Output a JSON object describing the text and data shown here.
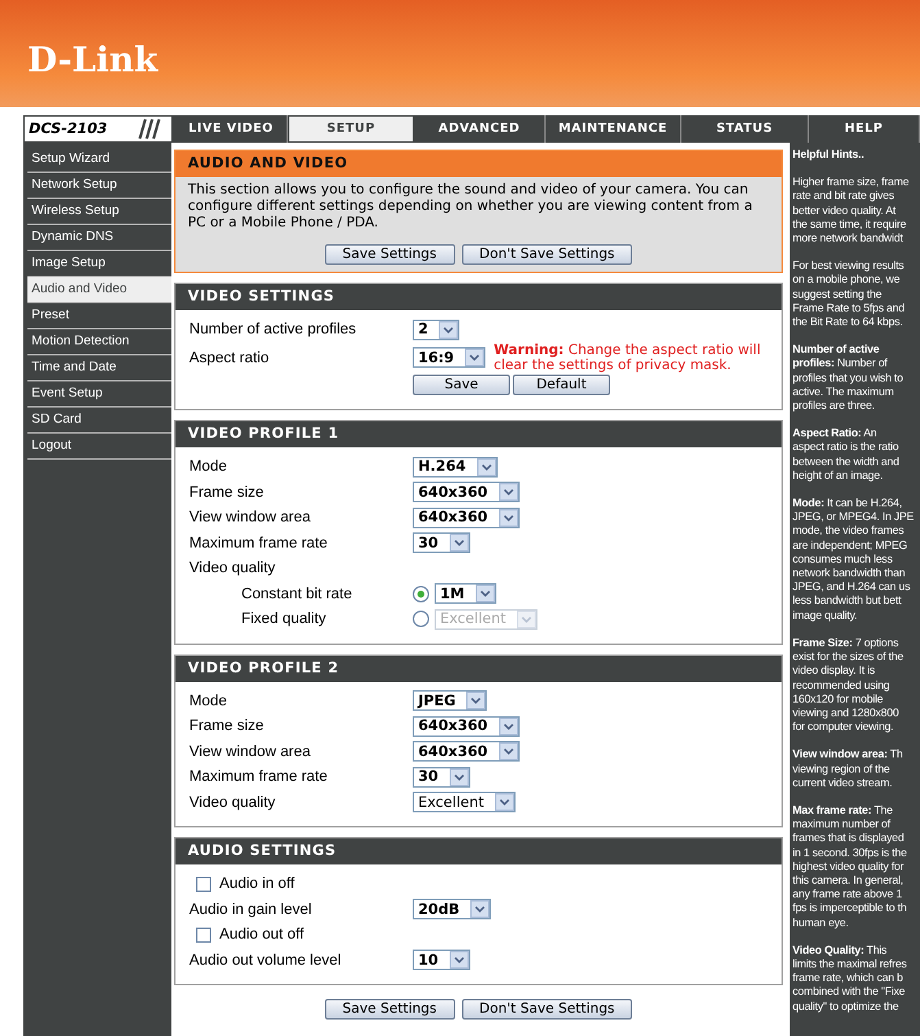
{
  "header": {
    "logo": "D-Link",
    "model": "DCS-2103"
  },
  "tabs": [
    {
      "label": "LIVE VIDEO",
      "selected": false
    },
    {
      "label": "SETUP",
      "selected": true
    },
    {
      "label": "ADVANCED",
      "selected": false
    },
    {
      "label": "MAINTENANCE",
      "selected": false
    },
    {
      "label": "STATUS",
      "selected": false
    },
    {
      "label": "HELP",
      "selected": false
    }
  ],
  "sidebar": {
    "items": [
      {
        "label": "Setup Wizard",
        "selected": false
      },
      {
        "label": "Network Setup",
        "selected": false
      },
      {
        "label": "Wireless Setup",
        "selected": false
      },
      {
        "label": "Dynamic DNS",
        "selected": false
      },
      {
        "label": "Image Setup",
        "selected": false
      },
      {
        "label": "Audio and Video",
        "selected": true
      },
      {
        "label": "Preset",
        "selected": false
      },
      {
        "label": "Motion Detection",
        "selected": false
      },
      {
        "label": "Time and Date",
        "selected": false
      },
      {
        "label": "Event Setup",
        "selected": false
      },
      {
        "label": "SD Card",
        "selected": false
      },
      {
        "label": "Logout",
        "selected": false
      }
    ]
  },
  "intro": {
    "title": "AUDIO AND VIDEO",
    "text": "This section allows you to configure the sound and video of your camera. You can configure different settings depending on whether you are viewing content from a PC or a Mobile Phone / PDA.",
    "buttons": [
      "Save Settings",
      "Don't Save Settings"
    ]
  },
  "sections": [
    {
      "title": "VIDEO SETTINGS",
      "rows": [
        {
          "kind": "select",
          "label": "Number of active profiles",
          "value": "2",
          "bold": true
        },
        {
          "kind": "warning",
          "label": "Aspect ratio",
          "value": "16:9",
          "bold": true,
          "warning": "**Warning:** Change the aspect ratio will clear the settings of privacy mask."
        },
        {
          "kind": "buttons",
          "buttons": [
            "Save",
            "Default"
          ]
        }
      ]
    },
    {
      "title": "VIDEO PROFILE 1",
      "rows": [
        {
          "kind": "select",
          "label": "Mode",
          "value": "H.264",
          "bold": true
        },
        {
          "kind": "select",
          "label": "Frame size",
          "value": "640x360",
          "bold": true
        },
        {
          "kind": "select",
          "label": "View window area",
          "value": "640x360",
          "bold": true
        },
        {
          "kind": "select",
          "label": "Maximum frame rate",
          "value": "30",
          "bold": true
        },
        {
          "kind": "heading",
          "label": "Video quality"
        },
        {
          "kind": "radio",
          "label": "Constant bit rate",
          "selected": true,
          "value": "1M",
          "bold": true,
          "disabled": false
        },
        {
          "kind": "radio",
          "label": "Fixed quality",
          "selected": false,
          "value": "Excellent",
          "bold": false,
          "disabled": true
        }
      ]
    },
    {
      "title": "VIDEO PROFILE 2",
      "rows": [
        {
          "kind": "select",
          "label": "Mode",
          "value": "JPEG",
          "bold": true
        },
        {
          "kind": "select",
          "label": "Frame size",
          "value": "640x360",
          "bold": true
        },
        {
          "kind": "select",
          "label": "View window area",
          "value": "640x360",
          "bold": true
        },
        {
          "kind": "select",
          "label": "Maximum frame rate",
          "value": "30",
          "bold": true
        },
        {
          "kind": "select",
          "label": "Video quality",
          "value": "Excellent",
          "bold": false
        }
      ]
    },
    {
      "title": "AUDIO SETTINGS",
      "rows": [
        {
          "kind": "checkbox",
          "label": "Audio in off",
          "checked": false
        },
        {
          "kind": "select",
          "label": "Audio in gain level",
          "value": "20dB",
          "bold": true
        },
        {
          "kind": "checkbox",
          "label": "Audio out off",
          "checked": false
        },
        {
          "kind": "select",
          "label": "Audio out volume level",
          "value": "10",
          "bold": true
        }
      ]
    }
  ],
  "footer_buttons": [
    "Save Settings",
    "Don't Save Settings"
  ],
  "help": {
    "title": "Helpful Hints..",
    "paragraphs": [
      [
        "Higher frame size, frame",
        "rate and bit rate gives",
        "better video quality. At",
        "the same time, it require",
        "more network bandwidt"
      ],
      [
        "For best viewing results",
        "on a mobile phone, we",
        "suggest setting the",
        "Frame Rate to 5fps and",
        "the Bit Rate to 64 kbps."
      ],
      [
        "**Number of active**",
        "**profiles:** Number of",
        "profiles that you wish to",
        "active. The maximum",
        "profiles are three."
      ],
      [
        "**Aspect Ratio:** An",
        "aspect ratio is the ratio",
        "between the width and",
        "height of an image."
      ],
      [
        "**Mode:** It can be H.264,",
        "JPEG, or MPEG4. In JPE",
        "mode, the video frames",
        "are independent; MPEG",
        "consumes much less",
        "network bandwidth than",
        "JPEG, and H.264 can us",
        "less bandwidth but bett",
        "image quality."
      ],
      [
        "**Frame Size:** 7 options",
        "exist for the sizes of the",
        "video display. It is",
        "recommended using",
        "160x120 for mobile",
        "viewing and 1280x800",
        "for computer viewing."
      ],
      [
        "**View window area:** Th",
        "viewing region of the",
        "current video stream."
      ],
      [
        "**Max frame rate:** The",
        "maximum number of",
        "frames that is displayed",
        "in 1 second. 30fps is the",
        "highest video quality for",
        "this camera. In general,",
        "any frame rate above 1",
        "fps is imperceptible to th",
        "human eye."
      ],
      [
        "**Video Quality:** This",
        "limits the maximal refres",
        "frame rate, which can b",
        "combined with the \"Fixe",
        "quality\" to optimize the"
      ]
    ]
  }
}
